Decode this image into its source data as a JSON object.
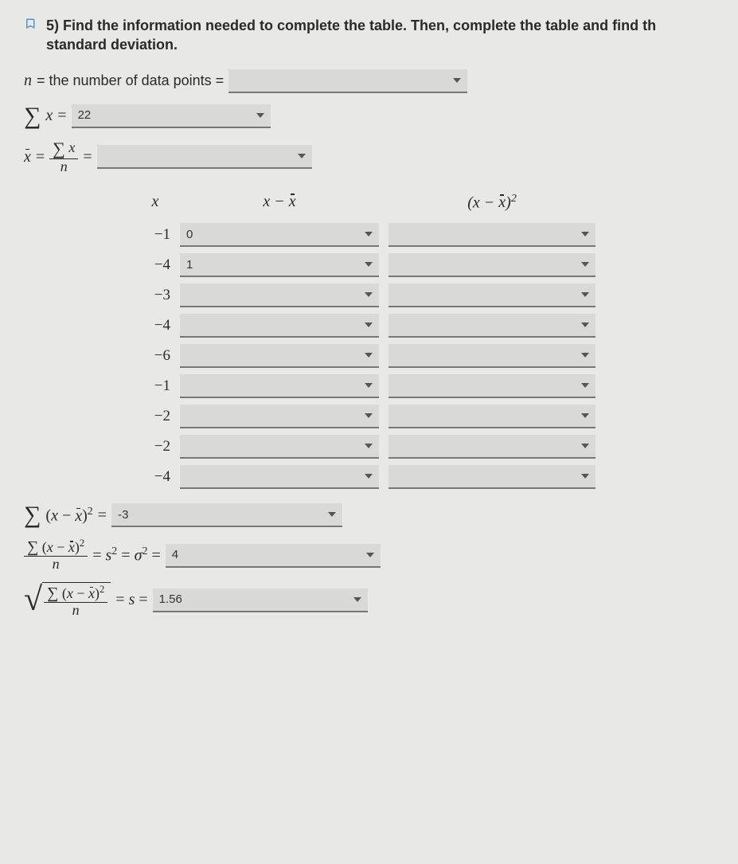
{
  "question": {
    "number": "5)",
    "text_bold": "Find the information needed to complete the table. Then, complete the table and find th",
    "text_plain": "standard deviation."
  },
  "lines": {
    "n_label_pre": "n",
    "n_label_mid": " = the number of data points = ",
    "n_value": "",
    "sumx_pre": "x",
    "sumx_eq": " = ",
    "sumx_value": "22",
    "mean_lhs": "x̄",
    "mean_eq": " = ",
    "mean_value": "",
    "ssq_eq": " = ",
    "ssq_value": "-3",
    "var_eq_mid": "s",
    "var_eq_mid2": "σ",
    "var_value": "4",
    "sd_eq": "s",
    "sd_value": "1.56"
  },
  "table": {
    "headers": {
      "x": "x",
      "xmx": "x − x̄",
      "xmx2": "(x − x̄)"
    },
    "rows": [
      {
        "x": "−1",
        "xmx": "0",
        "xmx2": ""
      },
      {
        "x": "−4",
        "xmx": "1",
        "xmx2": ""
      },
      {
        "x": "−3",
        "xmx": "",
        "xmx2": ""
      },
      {
        "x": "−4",
        "xmx": "",
        "xmx2": ""
      },
      {
        "x": "−6",
        "xmx": "",
        "xmx2": ""
      },
      {
        "x": "−1",
        "xmx": "",
        "xmx2": ""
      },
      {
        "x": "−2",
        "xmx": "",
        "xmx2": ""
      },
      {
        "x": "−2",
        "xmx": "",
        "xmx2": ""
      },
      {
        "x": "−4",
        "xmx": "",
        "xmx2": ""
      }
    ]
  }
}
